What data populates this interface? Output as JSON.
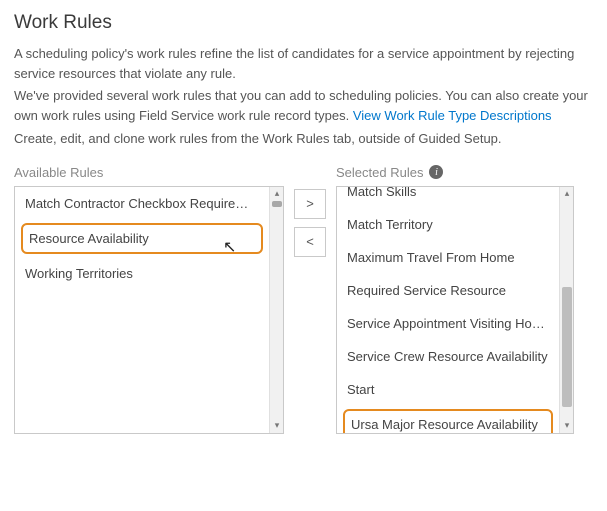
{
  "header": {
    "title": "Work Rules"
  },
  "intro": {
    "p1": "A scheduling policy's work rules refine the list of candidates for a service appointment by rejecting service resources that violate any rule.",
    "p2a": "We've provided several work rules that you can add to scheduling policies. You can also create your own work rules using Field Service work rule record types. ",
    "link": "View Work Rule Type Descriptions",
    "p3": "Create, edit, and clone work rules from the Work Rules tab, outside of Guided Setup."
  },
  "labels": {
    "available": "Available Rules",
    "selected": "Selected Rules"
  },
  "available_rules": [
    "Match Contractor Checkbox Requirement",
    "Resource Availability",
    "Working Territories"
  ],
  "selected_rules": [
    "Match Skills",
    "Match Territory",
    "Maximum Travel From Home",
    "Required Service Resource",
    "Service Appointment Visiting Hours",
    "Service Crew Resource Availability",
    "Start",
    "Ursa Major Resource Availability"
  ],
  "buttons": {
    "add": ">",
    "remove": "<"
  }
}
